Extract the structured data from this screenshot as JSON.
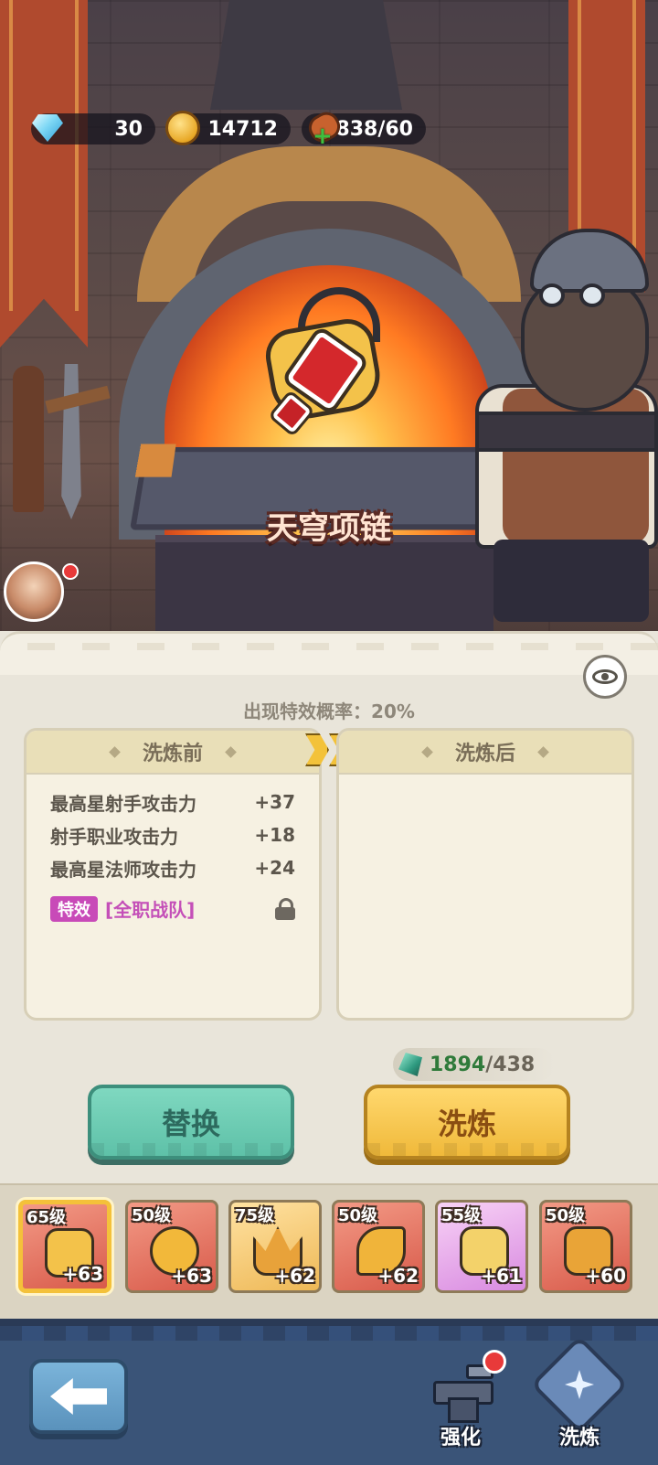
{
  "currencies": {
    "gems": "30",
    "coins": "14712",
    "stamina": "5838/60"
  },
  "item": {
    "name": "天穹项链"
  },
  "refine_panel": {
    "probability_text": "出现特效概率：20%",
    "before_title": "洗炼前",
    "after_title": "洗炼后",
    "before_stats": [
      {
        "name": "最高星射手攻击力",
        "value": "+37"
      },
      {
        "name": "射手职业攻击力",
        "value": "+18"
      },
      {
        "name": "最高星法师攻击力",
        "value": "+24"
      }
    ],
    "special_tag": "特效",
    "special_value": "[全职战队]",
    "cost_have": "1894",
    "cost_need": "/438"
  },
  "buttons": {
    "replace": "替换",
    "refine": "洗炼"
  },
  "equipment": [
    {
      "level": "65级",
      "bonus": "+63",
      "rarity": "red",
      "selected": true,
      "icon": "necklace-icon"
    },
    {
      "level": "50级",
      "bonus": "+63",
      "rarity": "red",
      "selected": false,
      "icon": "ring-icon"
    },
    {
      "level": "75级",
      "bonus": "+62",
      "rarity": "gold",
      "selected": false,
      "icon": "crown-icon"
    },
    {
      "level": "50级",
      "bonus": "+62",
      "rarity": "red",
      "selected": false,
      "icon": "horn-icon"
    },
    {
      "level": "55级",
      "bonus": "+61",
      "rarity": "purple",
      "selected": false,
      "icon": "boots-icon"
    },
    {
      "level": "50级",
      "bonus": "+60",
      "rarity": "red",
      "selected": false,
      "icon": "armor-icon"
    }
  ],
  "nav": {
    "strengthen": "强化",
    "refine": "洗炼"
  },
  "colors": {
    "replace_button": "#5ec1a8",
    "refine_button": "#f0b93a",
    "special": "#c84ab8",
    "navbar": "#3a5478"
  }
}
